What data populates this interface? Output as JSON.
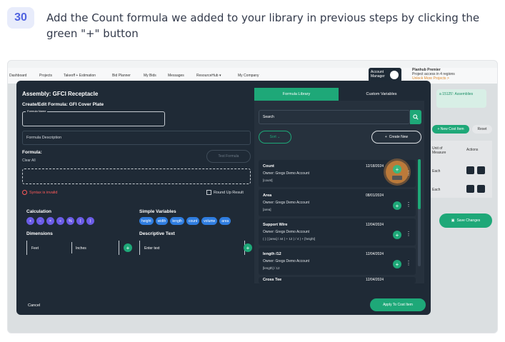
{
  "step": {
    "number": "30",
    "instruction": "Add the Count formula we added to your library in previous steps by clicking the green \"+\" button"
  },
  "app": {
    "nav": [
      "Dashboard",
      "Projects",
      "Takeoff + Estimation",
      "Bid Planner",
      "My Bids",
      "Messages",
      "ResourceHub ▾",
      "My Company"
    ],
    "account_label": "Account Manager",
    "plan_title": "Planhub Premier",
    "plan_sub": "Project access in 4 regions",
    "plan_link": "Unlock More Projects >",
    "notice": "a 15125': Assemblies",
    "new_cost_item": "+ New Cost Item",
    "reset": "Reset",
    "col_unit": "Unit of Measure",
    "col_actions": "Actions",
    "row1_unit": "Each",
    "row2_unit": "Each",
    "save_changes": "Save Changes"
  },
  "modal": {
    "title": "Assembly: GFCI Receptacle",
    "subtitle": "Create/Edit Formula: GFI Cover Plate",
    "formula_name_label": "Formula Name",
    "formula_name_value": "",
    "formula_description": "Formula Description",
    "formula_label": "Formula:",
    "clear_all": "Clear All",
    "test_formula": "Test Formula",
    "syntax_invalid": "Syntax is invalid",
    "round_up": "Round Up Result",
    "calculation": "Calculation",
    "operators": [
      "+",
      "−",
      "×",
      "÷",
      "%",
      "(",
      ")"
    ],
    "simple_variables": "Simple Variables",
    "variables": [
      "height",
      "width",
      "length",
      "count",
      "volume",
      "area"
    ],
    "dimensions": "Dimensions",
    "feet": "Feet",
    "inches": "Inches",
    "descriptive_text": "Descriptive Text",
    "enter_text": "Enter text",
    "cancel": "Cancel",
    "apply": "Apply To Cost Item"
  },
  "library": {
    "tab_library": "Formula Library",
    "tab_custom": "Custom Variables",
    "search_placeholder": "Search",
    "sort": "Sort ⌄",
    "create_new": "Create New",
    "cards": [
      {
        "name": "Count",
        "owner": "Owner: Gregs Demo Account",
        "expr": "[count]",
        "date": "12/18/2024"
      },
      {
        "name": "Area",
        "owner": "Owner: Gregs Demo Account",
        "expr": "[area]",
        "date": "08/01/2024"
      },
      {
        "name": "Support Wire",
        "owner": "Owner: Gregs Demo Account",
        "expr": "( ( ( [area] / 44 ) + 12 ) / 4 ) + [height]",
        "date": "12/04/2024"
      },
      {
        "name": "length /12",
        "owner": "Owner: Gregs Demo Account",
        "expr": "[length] / 12",
        "date": "12/04/2024"
      },
      {
        "name": "Cross Tee",
        "owner": "",
        "expr": "",
        "date": "12/04/2024"
      }
    ]
  },
  "colors": {
    "accent": "#1ea878",
    "step_badge": "#5063e0",
    "modal_bg": "#1f2a36",
    "highlight": "#f0963c",
    "error": "#ff5a5a"
  }
}
